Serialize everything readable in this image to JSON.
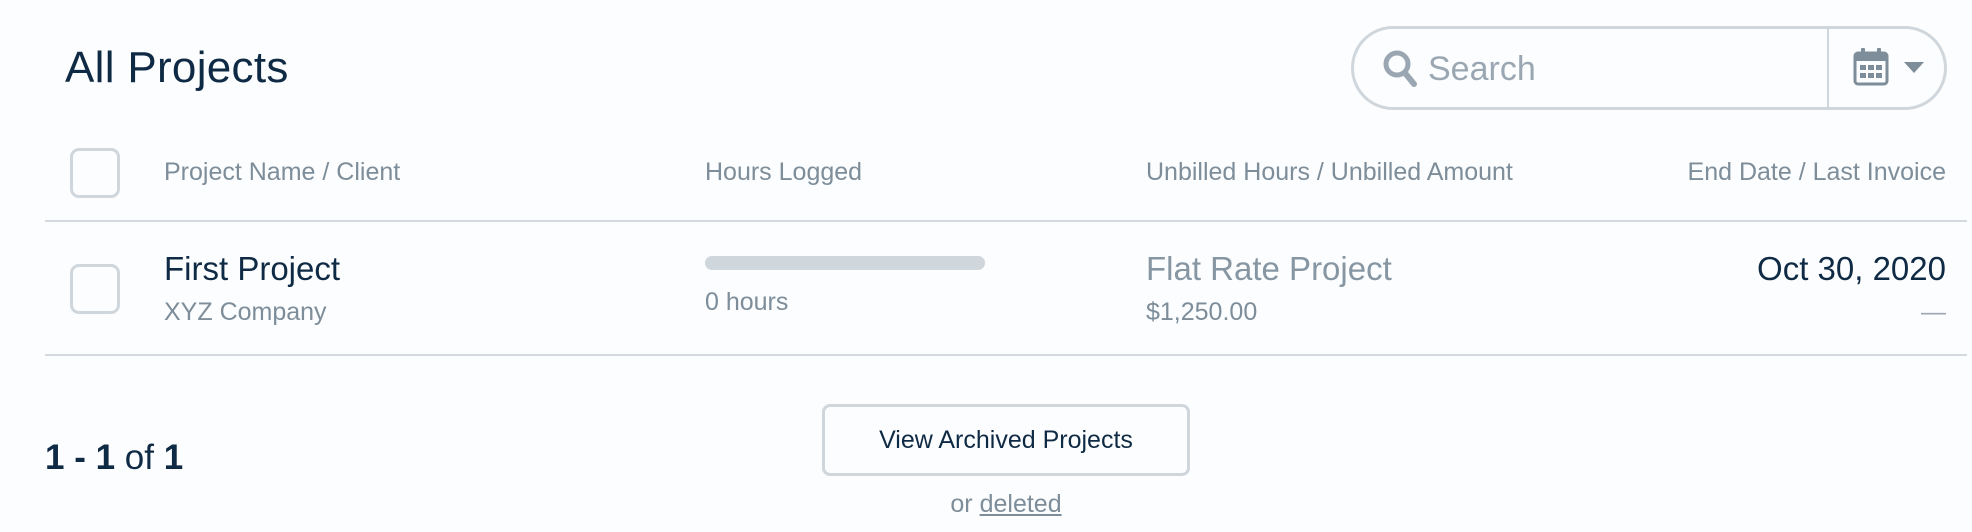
{
  "header": {
    "title": "All Projects"
  },
  "search": {
    "placeholder": "Search",
    "value": "",
    "icon": "search-icon",
    "date_filter_icon": "calendar-icon",
    "date_filter_caret_icon": "caret-down-icon"
  },
  "table": {
    "columns": [
      "Project Name / Client",
      "Hours Logged",
      "Unbilled Hours / Unbilled Amount",
      "End Date / Last Invoice"
    ],
    "rows": [
      {
        "project_name": "First Project",
        "client": "XYZ Company",
        "hours_progress": 0,
        "hours_text": "0 hours",
        "billing_type": "Flat Rate Project",
        "unbilled_amount": "$1,250.00",
        "end_date": "Oct 30, 2020",
        "last_invoice": "—"
      }
    ]
  },
  "pagination": {
    "start": "1",
    "separator": "-",
    "end": "1",
    "of_label": "of",
    "total": "1"
  },
  "footer": {
    "archived_button_label": "View Archived Projects",
    "or_label": "or",
    "deleted_link_label": "deleted"
  },
  "colors": {
    "text_primary": "#0f2a44",
    "text_muted": "#7d8d99",
    "border": "#cfd6dc",
    "background": "#fcfdfe"
  }
}
